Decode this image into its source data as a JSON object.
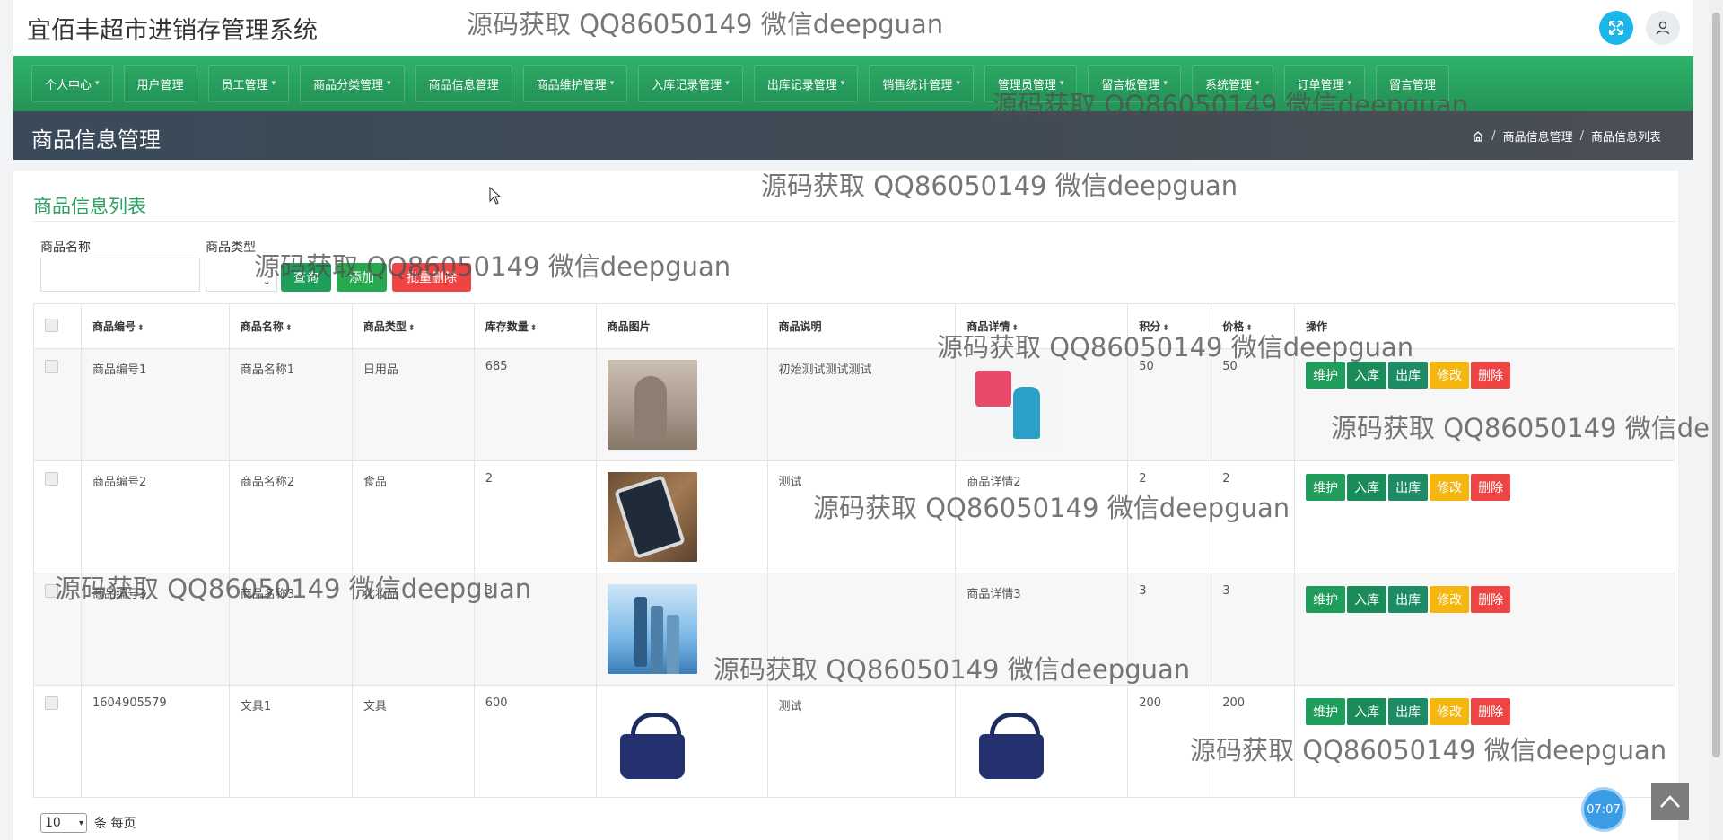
{
  "app": {
    "title": "宜佰丰超市进销存管理系统"
  },
  "nav": {
    "items": [
      {
        "label": "个人中心",
        "dropdown": true
      },
      {
        "label": "用户管理",
        "dropdown": false
      },
      {
        "label": "员工管理",
        "dropdown": true
      },
      {
        "label": "商品分类管理",
        "dropdown": true
      },
      {
        "label": "商品信息管理",
        "dropdown": false
      },
      {
        "label": "商品维护管理",
        "dropdown": true
      },
      {
        "label": "入库记录管理",
        "dropdown": true
      },
      {
        "label": "出库记录管理",
        "dropdown": true
      },
      {
        "label": "销售统计管理",
        "dropdown": true
      },
      {
        "label": "管理员管理",
        "dropdown": true
      },
      {
        "label": "留言板管理",
        "dropdown": true
      },
      {
        "label": "系统管理",
        "dropdown": true
      },
      {
        "label": "订单管理",
        "dropdown": true
      },
      {
        "label": "留言管理",
        "dropdown": false
      }
    ]
  },
  "header": {
    "page_title": "商品信息管理",
    "breadcrumb": [
      "商品信息管理",
      "商品信息列表"
    ]
  },
  "card": {
    "title": "商品信息列表"
  },
  "filters": {
    "name_label": "商品名称",
    "name_value": "",
    "type_label": "商品类型",
    "type_value": "",
    "search_button": "查询",
    "add_button": "添加",
    "batch_delete_button": "批量删除"
  },
  "table": {
    "columns": [
      "商品编号",
      "商品名称",
      "商品类型",
      "库存数量",
      "商品图片",
      "商品说明",
      "商品详情",
      "积分",
      "价格",
      "操作"
    ],
    "rows": [
      {
        "code": "商品编号1",
        "name": "商品名称1",
        "type": "日用品",
        "stock": "685",
        "image": "dress",
        "desc": "初始测试测试测试",
        "detail": "",
        "detail_image": "sale",
        "points": "50",
        "price": "50"
      },
      {
        "code": "商品编号2",
        "name": "商品名称2",
        "type": "食品",
        "stock": "2",
        "image": "tablet",
        "desc": "测试",
        "detail": "商品详情2",
        "detail_image": "",
        "points": "2",
        "price": "2"
      },
      {
        "code": "商品编号3",
        "name": "商品名称3",
        "type": "化妆品",
        "stock": "3",
        "image": "cosmetic",
        "desc": "",
        "detail": "商品详情3",
        "detail_image": "",
        "points": "3",
        "price": "3"
      },
      {
        "code": "1604905579",
        "name": "文具1",
        "type": "文具",
        "stock": "600",
        "image": "bag",
        "desc": "测试",
        "detail": "",
        "detail_image": "bag",
        "points": "200",
        "price": "200"
      }
    ],
    "actions": [
      "维护",
      "入库",
      "出库",
      "修改",
      "删除"
    ]
  },
  "pager": {
    "page_size": "10",
    "suffix": "条 每页"
  },
  "watermark": {
    "text": "源码获取 QQ86050149 微信deepguan",
    "text_cut": "源码获取 QQ86050149 微信dee"
  },
  "widgets": {
    "time": "07:07"
  },
  "colors": {
    "nav_green": "#2aa160",
    "title_green": "#2aa160",
    "accent_blue": "#1ab7ea",
    "danger_red": "#ef4444",
    "warning_yellow": "#f5b70e"
  }
}
